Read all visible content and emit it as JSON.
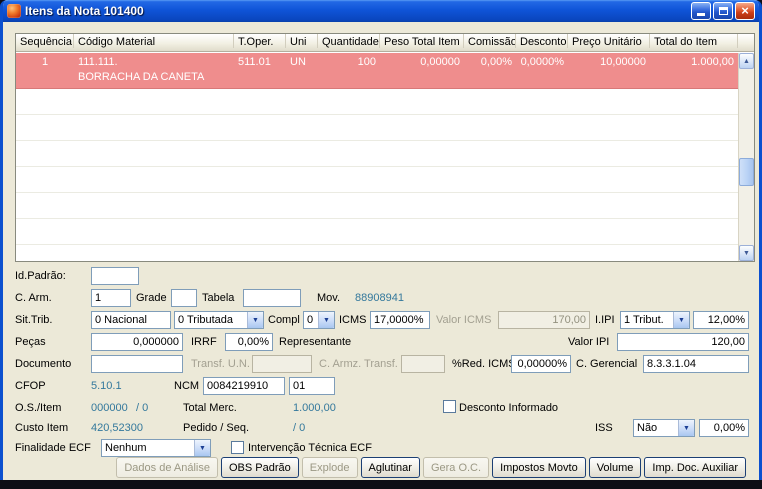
{
  "window": {
    "title": "Itens da Nota 101400"
  },
  "icons": {
    "close": "×",
    "combo_arrow": "▼",
    "scroll_up": "▲",
    "scroll_down": "▼"
  },
  "table": {
    "columns": [
      "Sequência",
      "Código Material",
      "T.Oper.",
      "Uni",
      "Quantidade",
      "Peso Total Item",
      "Comissão",
      "Desconto",
      "Preço Unitário",
      "Total do Item"
    ],
    "row": {
      "sequencia": "1",
      "codigo_material": "111.111.",
      "codigo_material_desc": "BORRACHA DA CANETA",
      "t_oper": "511.01",
      "uni": "UN",
      "quantidade": "100",
      "peso_total_item": "0,00000",
      "comissao": "0,00%",
      "desconto": "0,0000%",
      "preco_unitario": "10,00000",
      "total_do_item": "1.000,00"
    }
  },
  "fields": {
    "id_padrao": {
      "label": "Id.Padrão:",
      "value": ""
    },
    "c_arm": {
      "label": "C. Arm.",
      "value": "1"
    },
    "grade": {
      "label": "Grade",
      "value": ""
    },
    "tabela": {
      "label": "Tabela",
      "value": ""
    },
    "mov": {
      "label": "Mov.",
      "value": "88908941"
    },
    "sit_trib": {
      "label": "Sit.Trib.",
      "value": "0 Nacional",
      "selected": "0 Tributada"
    },
    "compl": {
      "label": "Compl",
      "selected": "0"
    },
    "icms": {
      "label": "ICMS",
      "value": "17,0000%"
    },
    "valor_icms": {
      "label": "Valor ICMS",
      "value": "170,00"
    },
    "ipi": {
      "label": "I.IPI",
      "selected": "1 Tribut.",
      "percent": "12,00%"
    },
    "pecas": {
      "label": "Peças",
      "value": "0,000000"
    },
    "irrf": {
      "label": "IRRF",
      "value": "0,00%"
    },
    "representante": {
      "label": "Representante"
    },
    "valor_ipi": {
      "label": "Valor IPI",
      "value": "120,00"
    },
    "documento": {
      "label": "Documento",
      "value": ""
    },
    "transf_un": {
      "label": "Transf. U.N.",
      "value": ""
    },
    "c_armz_transf": {
      "label": "C. Armz. Transf.",
      "value": ""
    },
    "red_icms": {
      "label": "%Red. ICMS",
      "value": "0,00000%"
    },
    "c_gerencial": {
      "label": "C. Gerencial",
      "value": "8.3.3.1.04"
    },
    "cfop": {
      "label": "CFOP",
      "value": "5.10.1"
    },
    "ncm": {
      "label": "NCM",
      "value": "0084219910",
      "value2": "01"
    },
    "os_item": {
      "label": "O.S./Item",
      "value": "000000",
      "value2": "/ 0"
    },
    "total_merc": {
      "label": "Total Merc.",
      "value": "1.000,00"
    },
    "desconto_informado": {
      "label": "Desconto Informado",
      "checked": false
    },
    "custo_item": {
      "label": "Custo Item",
      "value": "420,52300"
    },
    "pedido_seq": {
      "label": "Pedido / Seq.",
      "value": "/ 0"
    },
    "iss": {
      "label": "ISS",
      "selected": "Não",
      "percent": "0,00%"
    },
    "finalidade_ecf": {
      "label": "Finalidade ECF",
      "selected": "Nenhum"
    },
    "intervencao_tecnica": {
      "label": "Intervenção Técnica ECF",
      "checked": false
    }
  },
  "buttons": [
    {
      "label": "Dados de Análise",
      "enabled": false
    },
    {
      "label": "OBS Padrão",
      "enabled": true
    },
    {
      "label": "Explode",
      "enabled": false
    },
    {
      "label": "Aglutinar",
      "enabled": true
    },
    {
      "label": "Gera O.C.",
      "enabled": false
    },
    {
      "label": "Impostos Movto",
      "enabled": true
    },
    {
      "label": "Volume",
      "enabled": true
    },
    {
      "label": "Imp. Doc. Auxiliar",
      "enabled": true
    }
  ],
  "colors": {
    "titlebar_blue": "#0f54d8",
    "window_bg": "#ece9d8",
    "selected_row": "#ef8d8d",
    "readonly_value": "#33789c",
    "close_button_red": "#cc3d18"
  }
}
